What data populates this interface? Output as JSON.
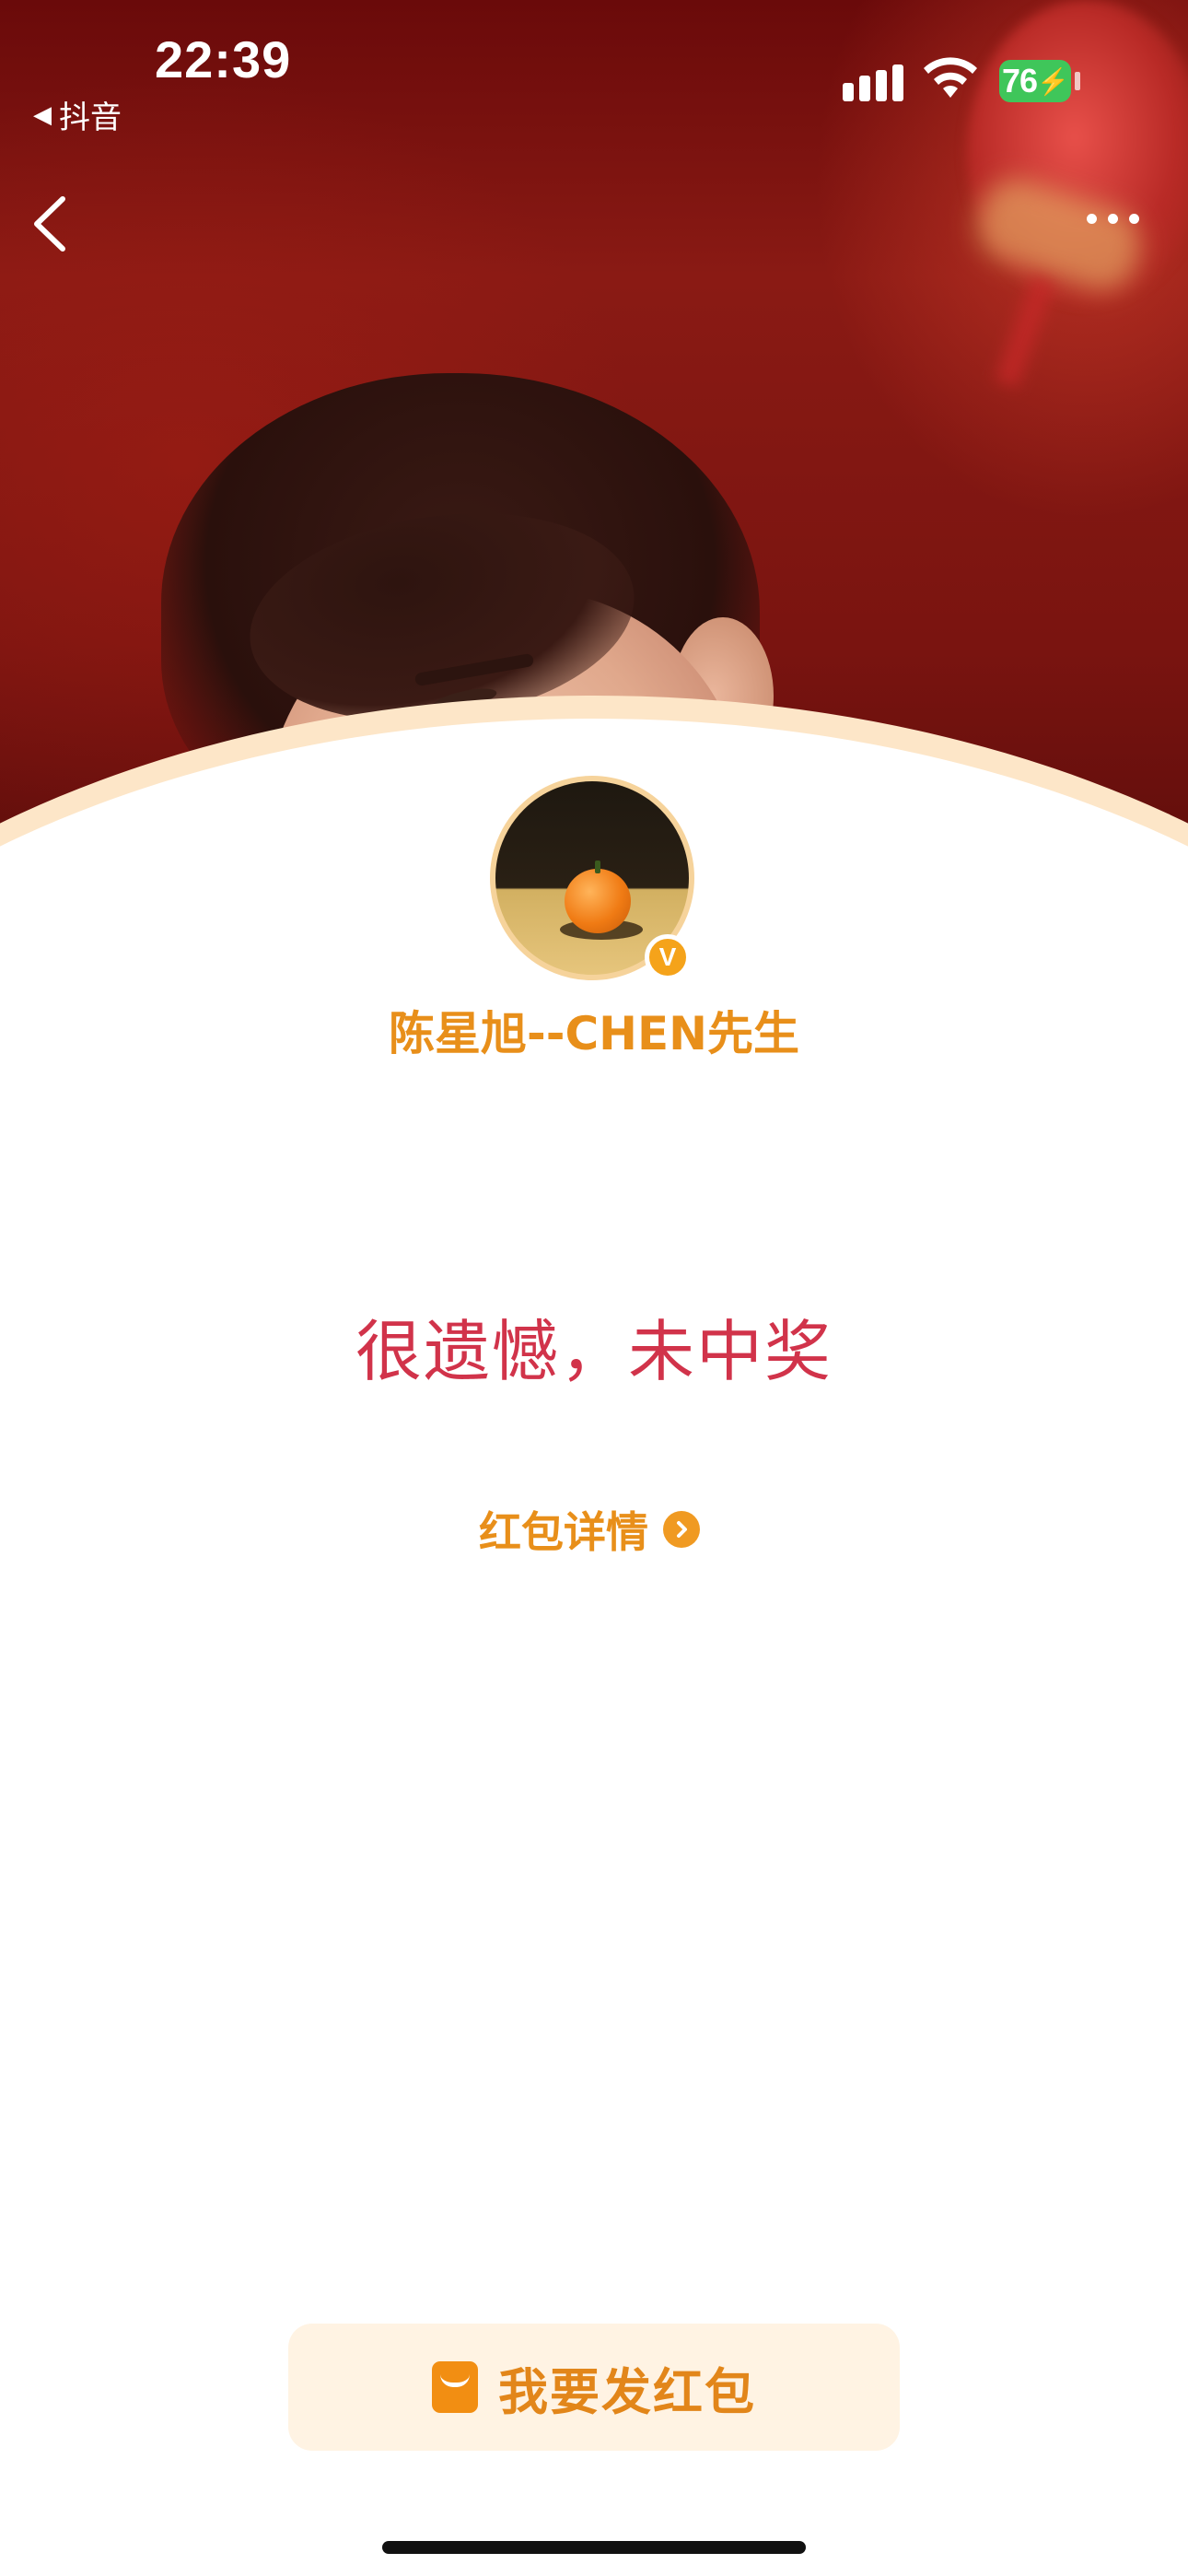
{
  "status_bar": {
    "time": "22:39",
    "back_app": "抖音",
    "battery": "76"
  },
  "profile": {
    "username": "陈星旭--CHEN先生",
    "verified_badge": "V"
  },
  "result": {
    "message": "很遗憾，未中奖",
    "detail_link": "红包详情"
  },
  "footer": {
    "send_button": "我要发红包"
  },
  "colors": {
    "accent_orange": "#e88f1a",
    "result_red": "#d1334a",
    "button_bg": "#fff3e3"
  }
}
